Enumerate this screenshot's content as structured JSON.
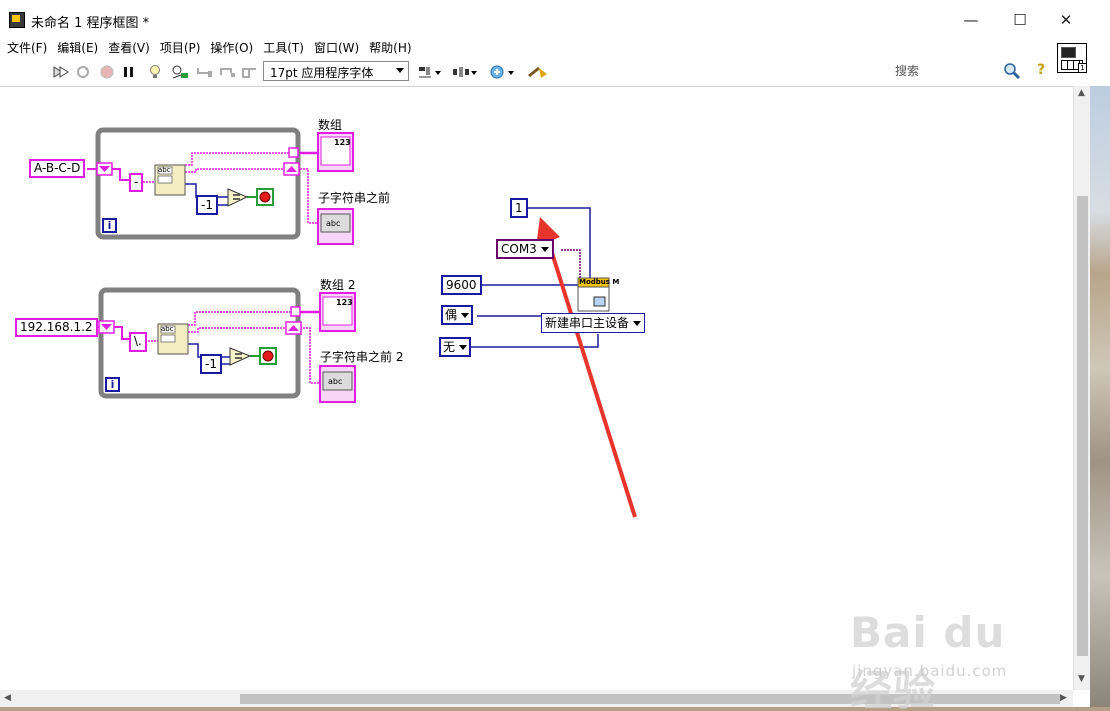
{
  "window": {
    "title": "未命名 1 程序框图 *",
    "minimize_glyph": "—",
    "maximize_glyph": "☐",
    "close_glyph": "✕"
  },
  "menu": {
    "items": [
      "文件(F)",
      "编辑(E)",
      "查看(V)",
      "项目(P)",
      "操作(O)",
      "工具(T)",
      "窗口(W)",
      "帮助(H)"
    ]
  },
  "toolbar": {
    "font_label": "17pt 应用程序字体",
    "search_placeholder": "搜索",
    "help_glyph": "?",
    "icons": [
      "run-arrow",
      "run-continuously",
      "abort",
      "pause",
      "highlight-execution",
      "retain-wire-values",
      "step-into",
      "step-over",
      "step-out",
      "align",
      "distribute",
      "reorder",
      "cleanup"
    ]
  },
  "vi_icon": {
    "badge": "1"
  },
  "diagram": {
    "loop1": {
      "input": "A-B-C-D",
      "delimiter": "-",
      "compare_const": "-1",
      "iteration": "i",
      "array_label": "数组",
      "substring_label": "子字符串之前",
      "array_indicator": "123",
      "substring_indicator": "abc",
      "index_label": "abc"
    },
    "loop2": {
      "input": "192.168.1.2",
      "delimiter": "\\.",
      "compare_const": "-1",
      "iteration": "i",
      "array_label": "数组 2",
      "substring_label": "子字符串之前 2",
      "array_indicator": "123",
      "substring_indicator": "abc",
      "index_label": "abc"
    },
    "modbus": {
      "slave_id": "1",
      "resource": "COM3",
      "baud": "9600",
      "parity": "偶",
      "flow": "无",
      "function_label": "Modbus M",
      "instance": "新建串口主设备"
    }
  },
  "watermark": {
    "logo": "Bai du 经验",
    "url": "jingyan.baidu.com"
  },
  "colors": {
    "string_wire": "#e21ee2",
    "numeric_wire": "#1a1aa0",
    "loop_border": "#808080",
    "annotation_arrow": "#e8352c"
  }
}
